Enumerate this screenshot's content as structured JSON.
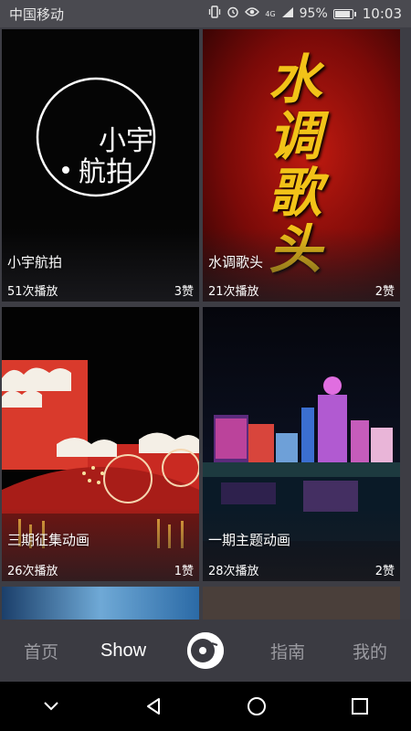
{
  "status_bar": {
    "carrier": "中国移动",
    "network": "4G",
    "battery_percent": "95%",
    "battery_level": 0.95,
    "time": "10:03"
  },
  "cards": [
    {
      "title": "小宇航拍",
      "plays": "51次播放",
      "likes": "3赞",
      "logo_text_1": "小宇",
      "logo_text_2": "航拍"
    },
    {
      "title": "水调歌头",
      "plays": "21次播放",
      "likes": "2赞",
      "art_text": "水调歌头"
    },
    {
      "title": "三期征集动画",
      "plays": "26次播放",
      "likes": "1赞"
    },
    {
      "title": "一期主题动画",
      "plays": "28次播放",
      "likes": "2赞"
    }
  ],
  "bottom_nav": {
    "home": "首页",
    "show": "Show",
    "guide": "指南",
    "mine": "我的"
  },
  "colors": {
    "app_background": "#3d3d44",
    "nav_active": "#ffffff",
    "nav_inactive": "#9a9aa0",
    "card2_red": "#b3120c",
    "card2_calligraphy": "#f2c318"
  }
}
